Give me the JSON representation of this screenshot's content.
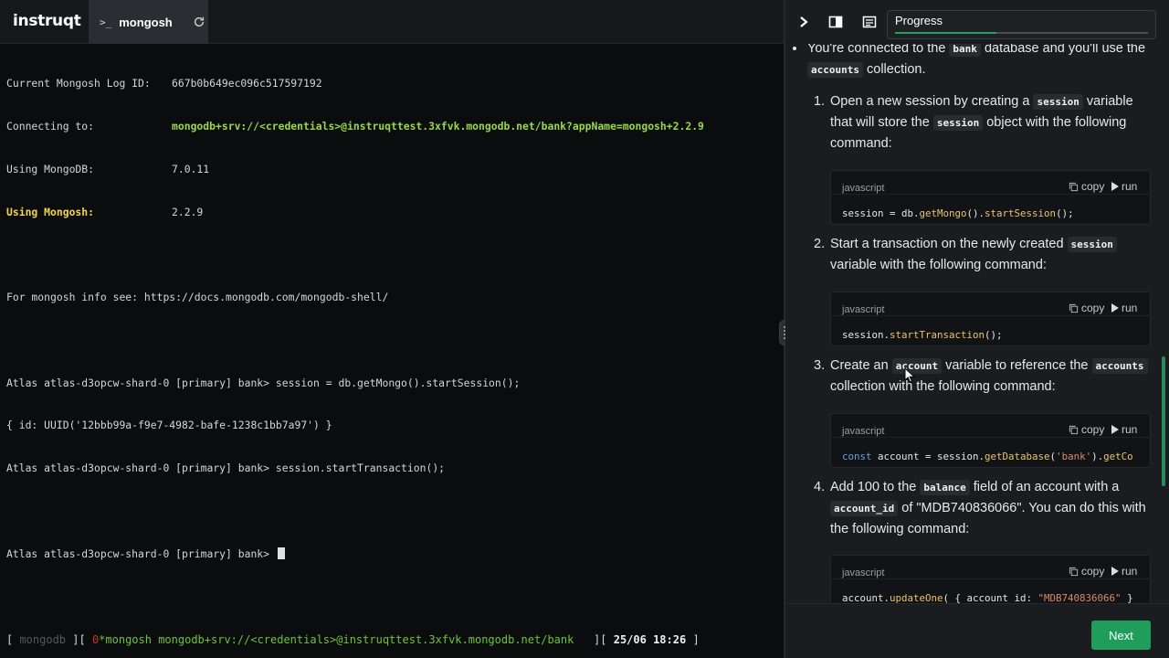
{
  "header": {
    "logo": "instruqt",
    "tab": {
      "prompt": ">_",
      "label": "mongosh",
      "icon": "refresh-icon"
    }
  },
  "terminal": {
    "lines": [
      {
        "label": "Current Mongosh Log ID:",
        "value": "667b0b649ec096c517597192"
      },
      {
        "label": "Connecting to:",
        "value": "mongodb+srv://<credentials>@instruqttest.3xfvk.mongodb.net/bank?appName=mongosh+2.2.9"
      },
      {
        "label": "Using MongoDB:",
        "value": "7.0.11"
      },
      {
        "label": "Using Mongosh:",
        "value": "2.2.9"
      },
      {
        "text": "For mongosh info see: https://docs.mongodb.com/mongodb-shell/"
      },
      {
        "text": "Atlas atlas-d3opcw-shard-0 [primary] bank> session = db.getMongo().startSession();"
      },
      {
        "text": "{ id: UUID('12bbb99a-f9e7-4982-bafe-1238c1bb7a97') }"
      },
      {
        "text": "Atlas atlas-d3opcw-shard-0 [primary] bank> session.startTransaction();"
      },
      {
        "text": "Atlas atlas-d3opcw-shard-0 [primary] bank> "
      }
    ]
  },
  "statusbar": {
    "open": "[",
    "session": " mongodb ",
    "sep": "][",
    "index": " 0",
    "window": "*mongosh mongodb+srv://<credentials>@instruqttest.3xfvk.mongodb.net/bank",
    "sep2": "][",
    "datetime": "25/06 18:26",
    "close": "]"
  },
  "panel": {
    "progress_label": "Progress",
    "progress_fraction": 0.4,
    "intro": {
      "pre": "You're connected to the",
      "code1": "bank",
      "mid": "database and you'll use the",
      "code2": "accounts",
      "post": "collection."
    },
    "steps": [
      {
        "num": "1.",
        "t1": "Open a new session by creating a",
        "c1": "session",
        "t2": "variable that will store the",
        "c2": "session",
        "t3": "object with the following command:",
        "lang": "javascript",
        "code": "session = db.getMongo().startSession();"
      },
      {
        "num": "2.",
        "t1": "Start a transaction on the newly created",
        "c1": "session",
        "t2": "variable with the following command:",
        "lang": "javascript",
        "code": "session.startTransaction();"
      },
      {
        "num": "3.",
        "t1": "Create an",
        "c1": "account",
        "t2": "variable to reference the",
        "c2": "accounts",
        "t3": "collection with the following command:",
        "lang": "javascript",
        "code": "const account = session.getDatabase('bank').getCo"
      },
      {
        "num": "4.",
        "t1": "Add 100 to the",
        "c1": "balance",
        "t2": "field of an account with a",
        "c2": "account_id",
        "t3": "of \"MDB740836066\". You can do this with the following command:",
        "lang": "javascript",
        "code": "account.updateOne( { account_id: \"MDB740836066\" }"
      }
    ],
    "copy_label": "copy",
    "run_label": "run",
    "next_label": "Next"
  }
}
